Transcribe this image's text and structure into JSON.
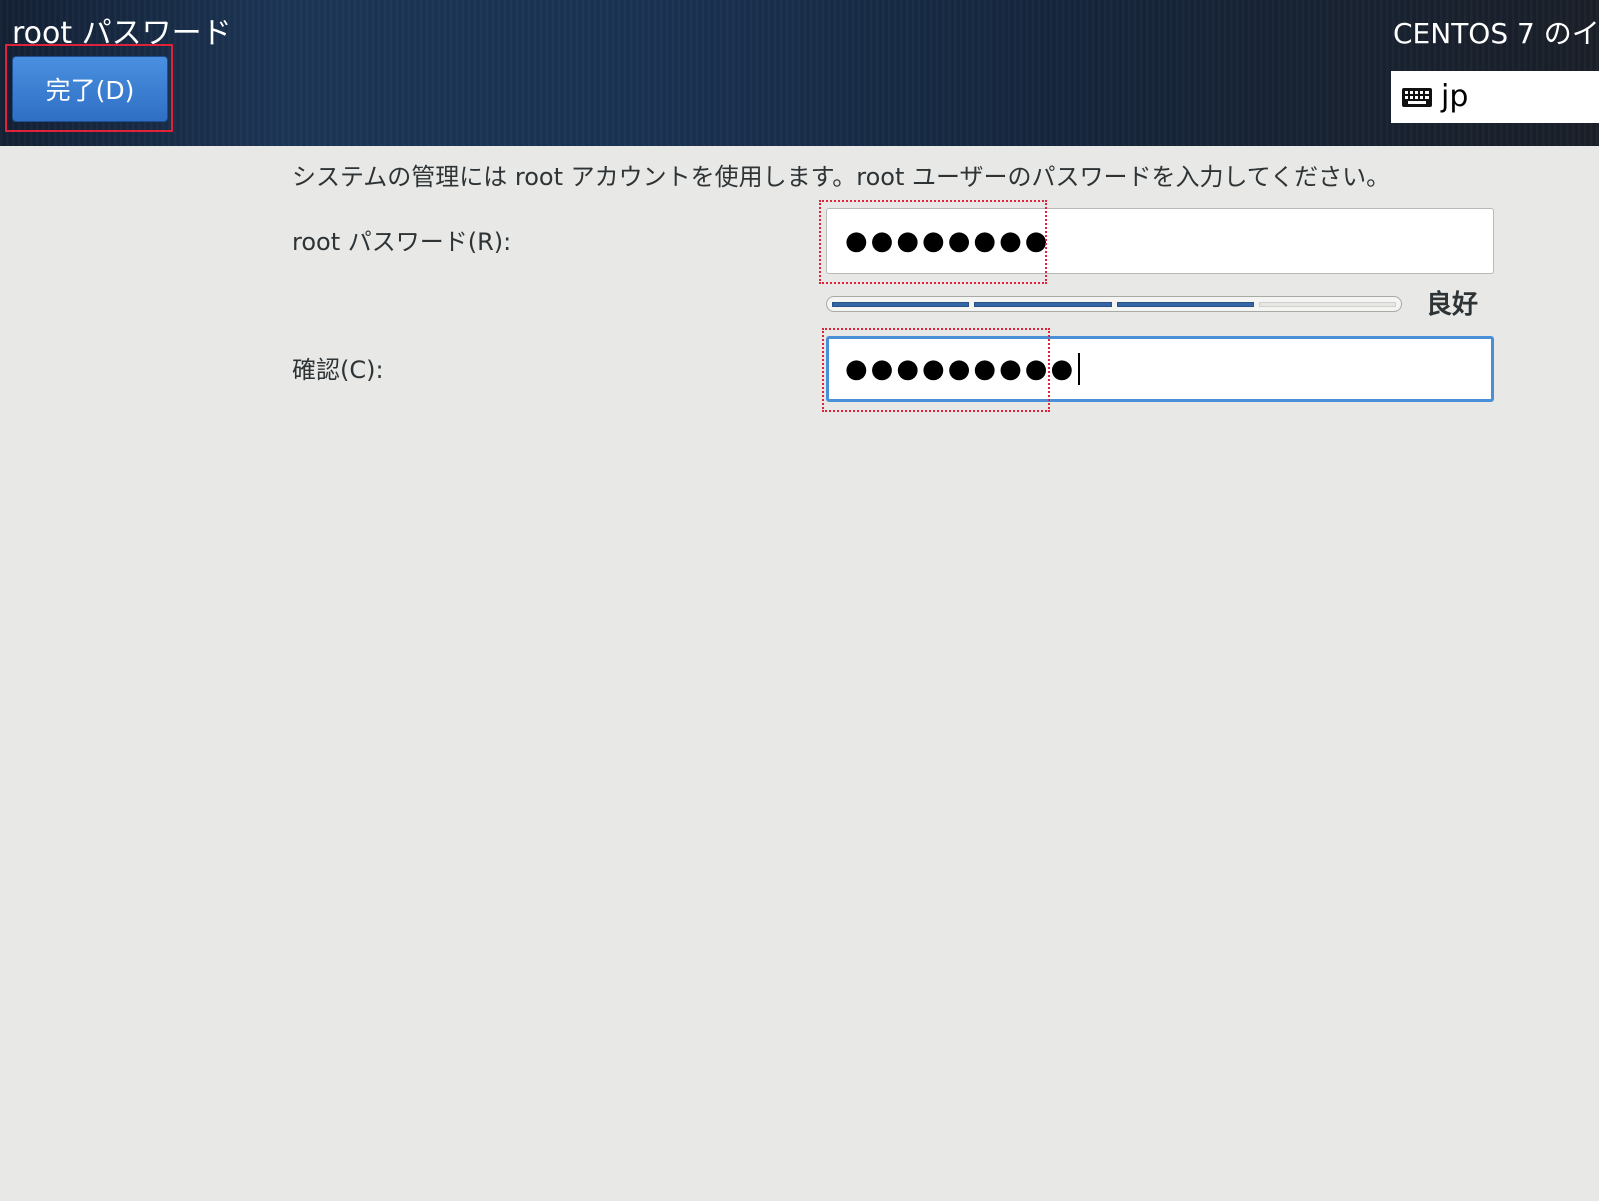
{
  "header": {
    "title": "root パスワード",
    "done_button": "完了(D)",
    "product": "CENTOS 7 のイ",
    "keyboard_layout": "jp",
    "keyboard_icon": "keyboard-icon"
  },
  "main": {
    "instructions": "システムの管理には root アカウントを使用します。root ユーザーのパスワードを入力してください。",
    "password_label": "root パスワード(R):",
    "password_value": "●●●●●●●●",
    "confirm_label": "確認(C):",
    "confirm_value": "●●●●●●●●●",
    "strength": {
      "label": "良好",
      "filled_segments": 3,
      "total_segments": 4,
      "fill_color": "#3465a4"
    }
  },
  "colors": {
    "accent": "#4a90d9",
    "highlight": "#e0233a"
  }
}
